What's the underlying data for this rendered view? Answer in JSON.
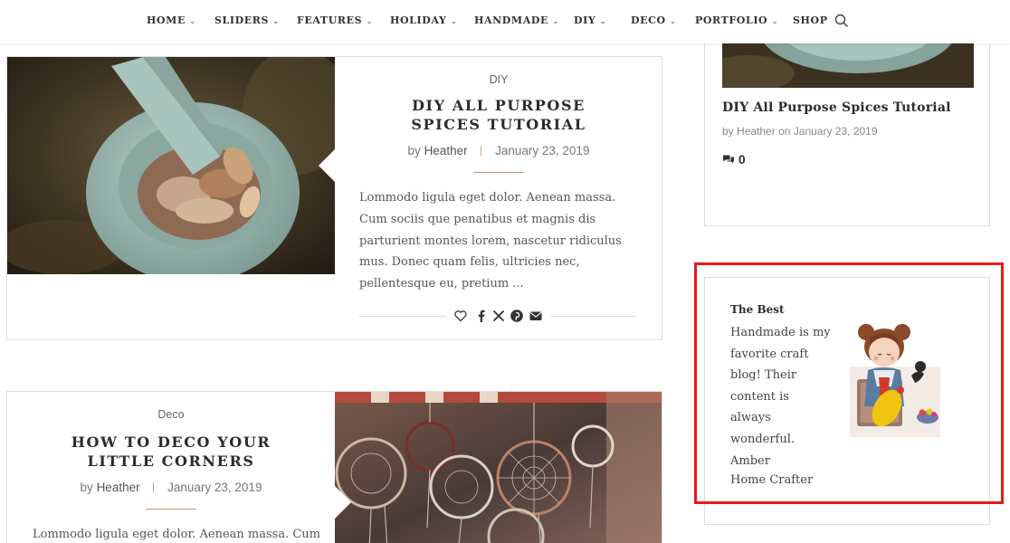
{
  "nav": {
    "items": [
      {
        "label": "HOME",
        "has_dropdown": true
      },
      {
        "label": "SLIDERS",
        "has_dropdown": true
      },
      {
        "label": "FEATURES",
        "has_dropdown": true
      },
      {
        "label": "HOLIDAY",
        "has_dropdown": true
      },
      {
        "label": "HANDMADE",
        "has_dropdown": true
      },
      {
        "label": "DIY",
        "has_dropdown": true
      },
      {
        "label": "DECO",
        "has_dropdown": true
      },
      {
        "label": "PORTFOLIO",
        "has_dropdown": true
      },
      {
        "label": "SHOP",
        "has_dropdown": false
      }
    ],
    "dropdown_icon": "chevron-down-icon",
    "search_icon": "search-icon"
  },
  "posts": [
    {
      "category": "DIY",
      "title": "DIY All Purpose Spices Tutorial",
      "by": "by",
      "author": "Heather",
      "date": "January 23, 2019",
      "excerpt": "Lommodo ligula eget dolor. Aenean massa. Cum sociis que penatibus et magnis dis parturient montes lorem, nascetur ridiculus mus. Donec quam felis, ultricies nec, pellentesque eu, pretium ...",
      "image": "mortar-and-pestle-with-spices",
      "share_icons": [
        "heart-icon",
        "facebook-icon",
        "x-icon",
        "pinterest-icon",
        "email-icon"
      ]
    },
    {
      "category": "Deco",
      "title": "How to Deco Your Little Corners",
      "by": "by",
      "author": "Heather",
      "date": "January 23, 2019",
      "excerpt": "Lommodo ligula eget dolor. Aenean massa. Cum",
      "image": "hanging-dreamcatchers"
    }
  ],
  "sidebar": {
    "recent_post": {
      "title": "DIY All Purpose Spices Tutorial",
      "by": "by",
      "author": "Heather",
      "on": "on",
      "date": "January 23, 2019",
      "comments": "0",
      "comments_icon": "comments-icon"
    },
    "testimonial": {
      "title": "The Best",
      "lines": [
        "Handmade is my",
        "favorite craft",
        "blog! Their",
        "content is",
        "always",
        "wonderful."
      ],
      "author": "Amber",
      "role": "Home Crafter",
      "image": "girl-crafting-illustration"
    }
  },
  "colors": {
    "accent": "#c19a7a",
    "highlight_border": "#e51b1b",
    "card_border": "#dedede",
    "text_dark": "#2c2c2c"
  }
}
